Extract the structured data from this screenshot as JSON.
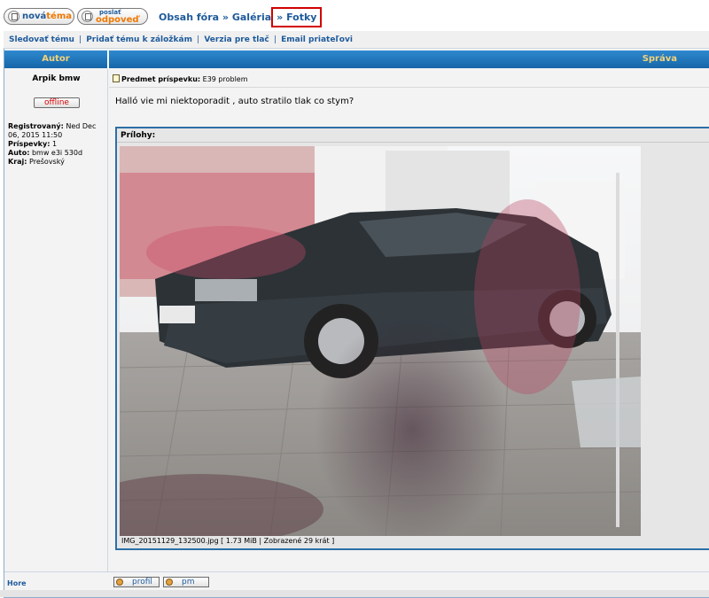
{
  "toolbar": {
    "new_topic": {
      "part1": "nová",
      "part2": "téma"
    },
    "reply": {
      "small": "poslať",
      "big": "odpoveď"
    }
  },
  "breadcrumb": {
    "item1": "Obsah fóra",
    "sep": "»",
    "item2": "Galéria",
    "item3": "Fotky"
  },
  "topic_links": {
    "follow": "Sledovať tému",
    "bookmark": "Pridať tému k záložkám",
    "print": "Verzia pre tlač",
    "email": "Email priateľovi",
    "separator": "|"
  },
  "table_headers": {
    "author": "Autor",
    "message": "Správa"
  },
  "post": {
    "author": "Arpik bmw",
    "status": "offline",
    "registered_label": "Registrovaný:",
    "registered_value": "Ned Dec 06, 2015 11:50",
    "posts_label": "Príspevky:",
    "posts_value": "1",
    "car_label": "Auto:",
    "car_value": "bmw e3i 530d",
    "region_label": "Kraj:",
    "region_value": "Prešovský",
    "subject_label": "Predmet príspevku:",
    "subject_value": "E39 problem",
    "message": "Halló vie mi niektoporadit , auto stratilo tlak co stym?",
    "attachments_label": "Prílohy:",
    "attachment_caption": "IMG_20151129_132500.jpg [ 1.73 MiB | Zobrazené 29 krát ]"
  },
  "footer": {
    "top_link": "Hore",
    "profile_btn": "profil",
    "pm_btn": "pm"
  },
  "colors": {
    "header_blue": "#1e6fb5",
    "header_text": "#f4d27a",
    "link": "#1e5a9b",
    "highlight": "#d10000",
    "offline": "#d00000"
  }
}
